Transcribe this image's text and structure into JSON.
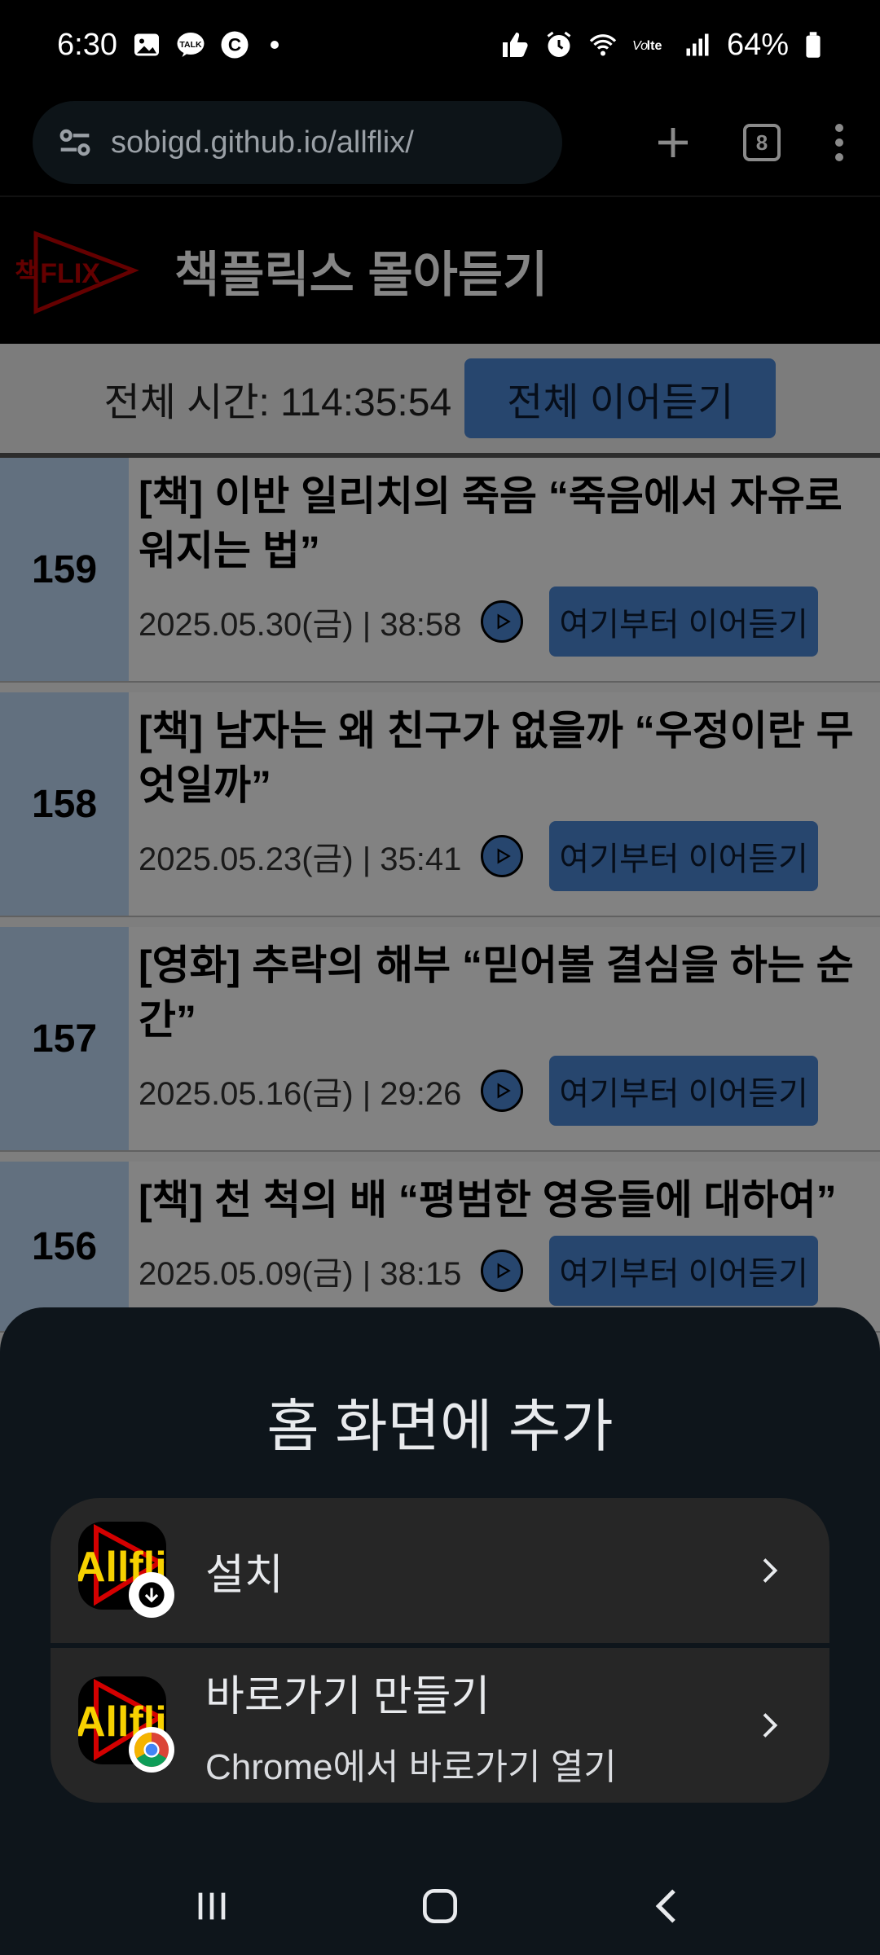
{
  "status_bar": {
    "time": "6:30",
    "battery": "64%",
    "left_icons": [
      "gallery-icon",
      "kakaotalk-icon",
      "c-icon",
      "dot"
    ],
    "right_icons": [
      "thumbs-up-icon",
      "alarm-icon",
      "wifi-icon",
      "volte-icon",
      "signal-icon",
      "battery-icon"
    ]
  },
  "browser": {
    "url": "sobigd.github.io/allflix/",
    "tab_count": "8"
  },
  "site": {
    "logo_text": "책FLIX",
    "title": "책플릭스 몰아듣기",
    "total_label": "전체 시간: 114:35:54",
    "play_all_label": "전체 이어듣기"
  },
  "episodes": [
    {
      "num": "159",
      "title": "[책] 이반 일리치의 죽음 “죽음에서 자유로워지는 법”",
      "meta": "2025.05.30(금) | 38:58",
      "resume": "여기부터 이어듣기"
    },
    {
      "num": "158",
      "title": "[책] 남자는 왜 친구가 없을까 “우정이란 무엇일까”",
      "meta": "2025.05.23(금) | 35:41",
      "resume": "여기부터 이어듣기"
    },
    {
      "num": "157",
      "title": "[영화] 추락의 해부 “믿어볼 결심을 하는 순간”",
      "meta": "2025.05.16(금) | 29:26",
      "resume": "여기부터 이어듣기"
    },
    {
      "num": "156",
      "title": "[책] 천 척의 배 “평범한 영웅들에 대하여”",
      "meta": "2025.05.09(금) | 38:15",
      "resume": "여기부터 이어듣기"
    }
  ],
  "sheet": {
    "title": "홈 화면에 추가",
    "app_icon_text": "Allflix",
    "install_label": "설치",
    "shortcut_label": "바로가기 만들기",
    "shortcut_sub": "Chrome에서 바로가기 열기"
  },
  "colors": {
    "accent_blue": "#4c86d4",
    "episode_num_bg": "#bcd6f4",
    "sheet_bg": "#0e151b",
    "option_bg": "#262626"
  }
}
